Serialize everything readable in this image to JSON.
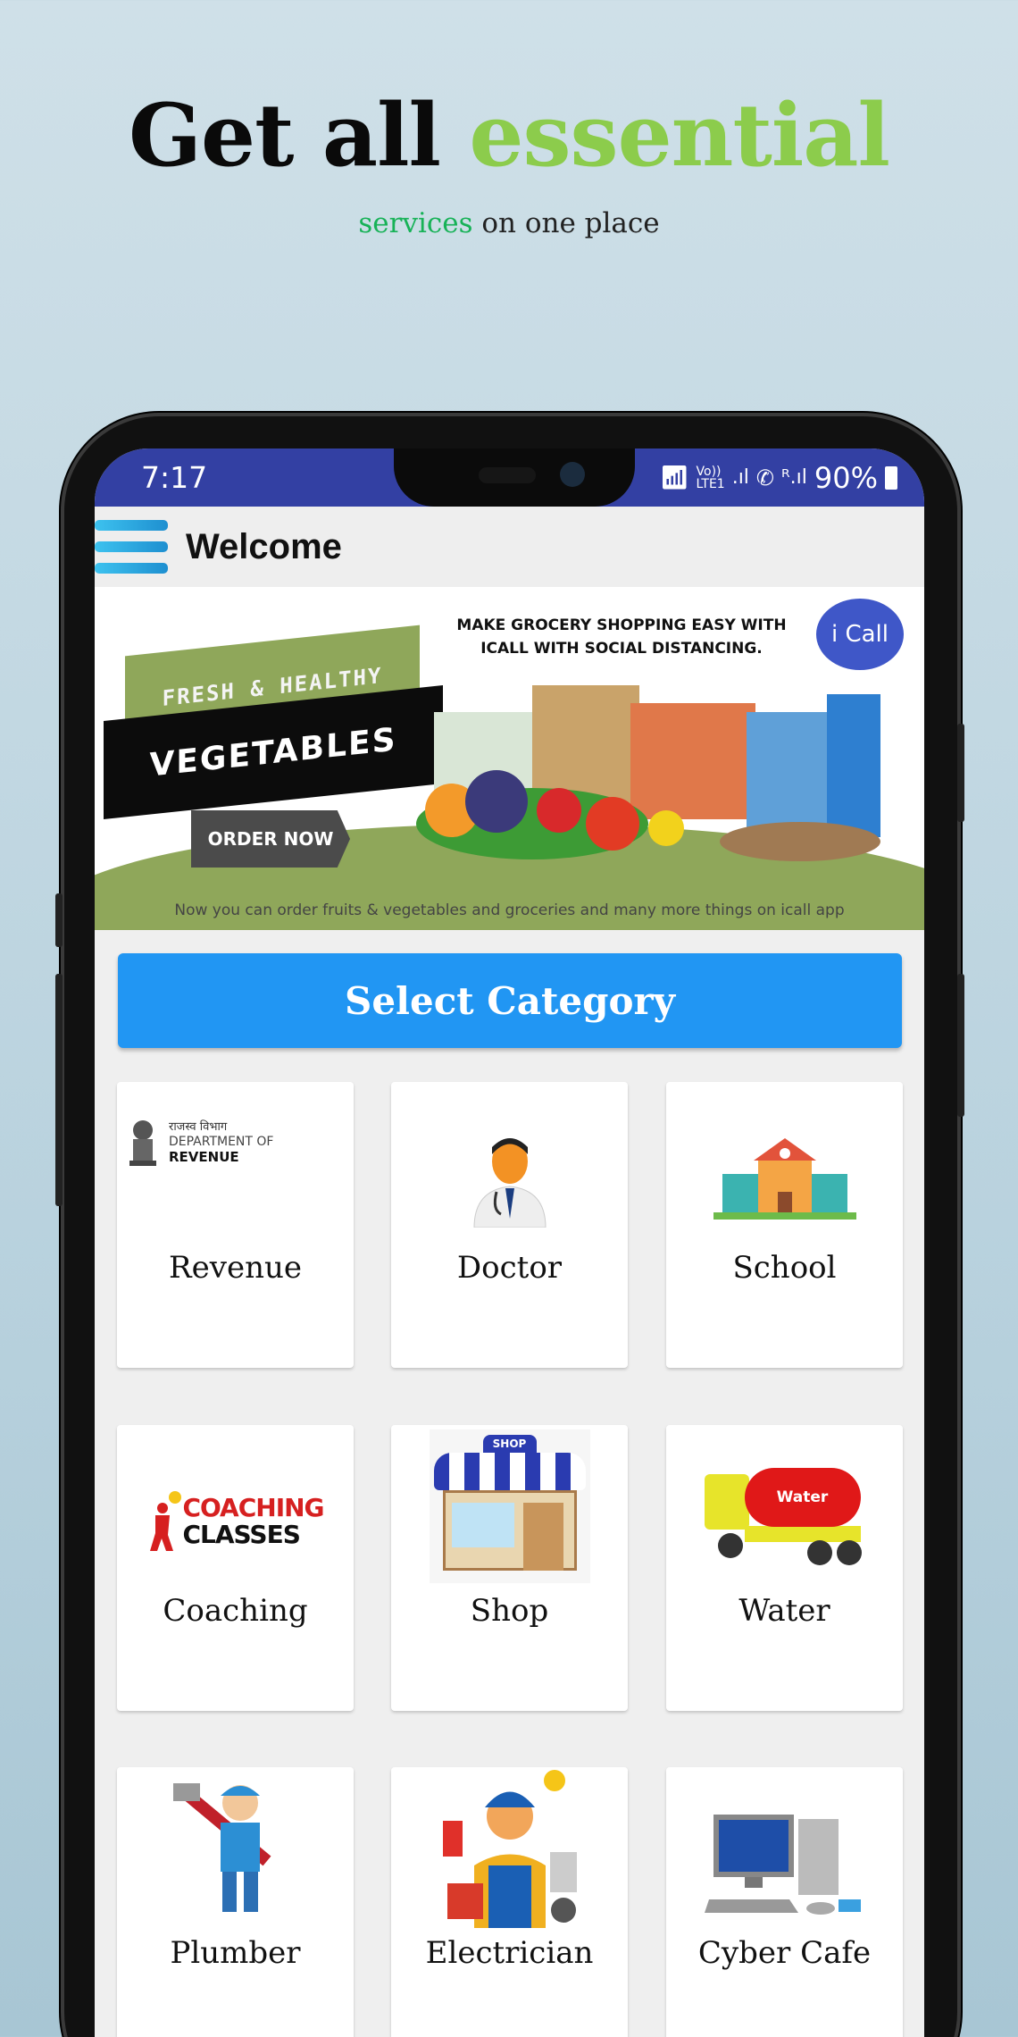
{
  "promo": {
    "headline_a": "Get all",
    "headline_b": "essential",
    "sub_a": "services",
    "sub_b": "on one place",
    "accent": "#8ccc4c"
  },
  "status_bar": {
    "time": "7:17",
    "battery": "90%",
    "icons": [
      "wifi-icon",
      "volte-lte1-icon",
      "signal-icon",
      "wifi-call-icon",
      "signal-roaming-icon",
      "battery-icon"
    ],
    "color": "#3340a3"
  },
  "app_bar": {
    "title": "Welcome",
    "menu_icon": "hamburger-icon"
  },
  "banner": {
    "tag": "FRESH & HEALTHY",
    "heading": "VEGETABLES",
    "cta": "ORDER NOW",
    "tagline": "MAKE GROCERY SHOPPING EASY WITH ICALL WITH SOCIAL DISTANCING.",
    "logo": "i Call",
    "note": "Now you can order fruits & vegetables and groceries and many more things on icall app"
  },
  "select_category": {
    "label": "Select Category",
    "color": "#2196f3"
  },
  "categories": [
    {
      "label": "Revenue",
      "icon": "department-of-revenue-logo",
      "logo_hi": "राजस्व विभाग",
      "logo_l1": "DEPARTMENT OF",
      "logo_l2": "REVENUE"
    },
    {
      "label": "Doctor",
      "icon": "doctor-icon"
    },
    {
      "label": "School",
      "icon": "school-building-icon"
    },
    {
      "label": "Coaching",
      "icon": "coaching-classes-logo",
      "logo_l1": "COACHING",
      "logo_l2": "CLASSES"
    },
    {
      "label": "Shop",
      "icon": "shop-storefront-icon",
      "logo_l1": "SHOP"
    },
    {
      "label": "Water",
      "icon": "water-tanker-icon",
      "logo_l1": "Water"
    },
    {
      "label": "Plumber",
      "icon": "plumber-icon"
    },
    {
      "label": "Electrician",
      "icon": "electrician-icon"
    },
    {
      "label": "Cyber Cafe",
      "icon": "computer-icon"
    }
  ]
}
